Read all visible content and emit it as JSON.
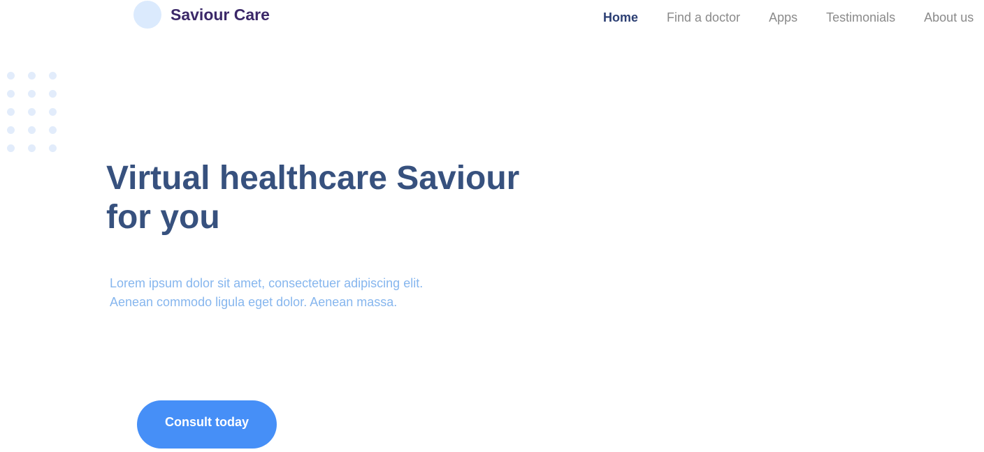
{
  "header": {
    "brand": "Saviour Care",
    "logo_icon": "circle-logo-icon",
    "nav": [
      {
        "label": "Home",
        "active": true
      },
      {
        "label": "Find a doctor",
        "active": false
      },
      {
        "label": "Apps",
        "active": false
      },
      {
        "label": "Testimonials",
        "active": false
      },
      {
        "label": "About us",
        "active": false
      }
    ]
  },
  "hero": {
    "title_line1": "Virtual healthcare Saviour",
    "title_line2": "for you",
    "text_line1": "Lorem ipsum dolor sit amet, consectetuer adipiscing elit.",
    "text_line2": "Aenean commodo ligula eget dolor. Aenean massa.",
    "cta_label": "Consult today"
  },
  "colors": {
    "brand": "#3b2868",
    "nav_active": "#2c3f73",
    "nav_inactive": "#8a8a8a",
    "title": "#37517e",
    "body_text": "#86b6ee",
    "cta_background": "#468ff7",
    "logo_circle": "#dbeafd",
    "decor_dots": "#e2ecfb"
  }
}
